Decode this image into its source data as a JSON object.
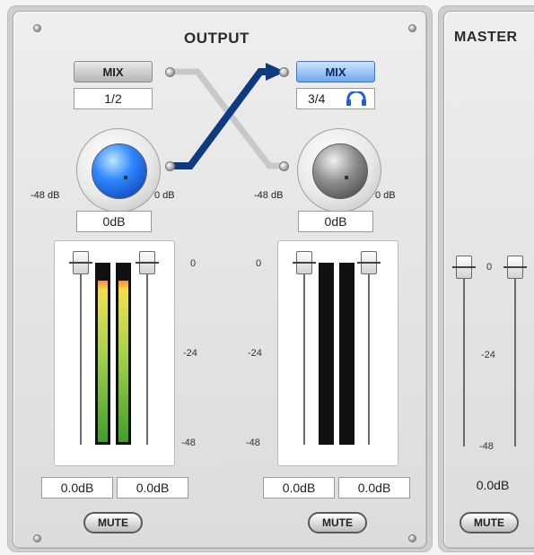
{
  "output": {
    "title": "OUTPUT",
    "ch12": {
      "mix_label": "MIX",
      "pair_label": "1/2",
      "knob_min": "-48 dB",
      "knob_max": "0 dB",
      "knob_value": "0dB",
      "scale": [
        "0",
        "-24",
        "-48"
      ],
      "readouts": [
        "0.0dB",
        "0.0dB"
      ],
      "mute_label": "MUTE"
    },
    "ch34": {
      "mix_label": "MIX",
      "pair_label": "3/4",
      "knob_min": "-48 dB",
      "knob_max": "0 dB",
      "knob_value": "0dB",
      "scale": [
        "0",
        "-24",
        "-48"
      ],
      "readouts": [
        "0.0dB",
        "0.0dB"
      ],
      "mute_label": "MUTE"
    }
  },
  "master": {
    "title": "MASTER",
    "scale": [
      "0",
      "-24",
      "-48"
    ],
    "readout": "0.0dB",
    "mute_label": "MUTE"
  },
  "icons": {
    "headphones": "headphones-icon"
  },
  "colors": {
    "mix_active": "#6fa8ee",
    "knob_active": "#2e86ff",
    "routing_line": "#0d3a80"
  }
}
